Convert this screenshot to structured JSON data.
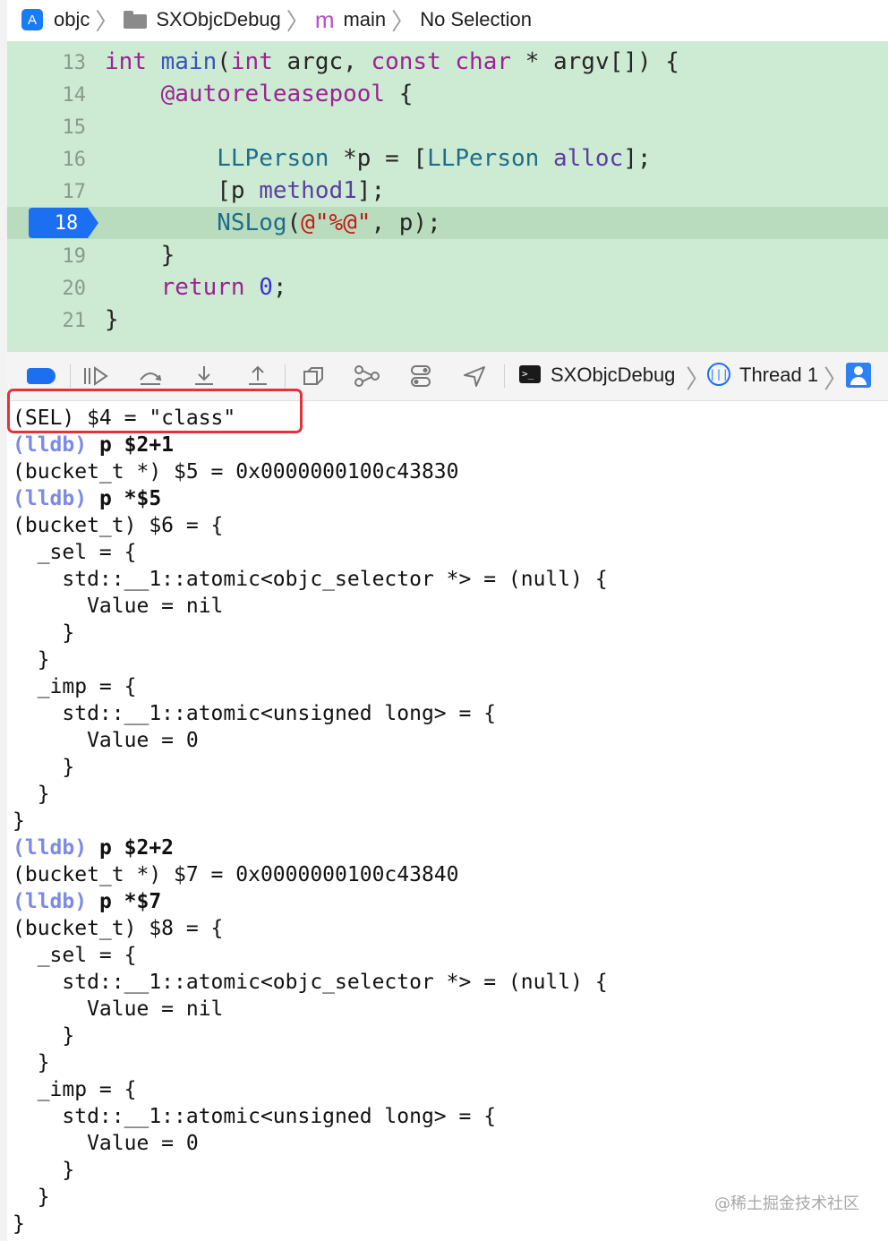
{
  "breadcrumb": {
    "project": "objc",
    "target": "SXObjcDebug",
    "file_icon_letter": "m",
    "function": "main",
    "selection": "No Selection"
  },
  "editor": {
    "lines": [
      {
        "num": "13",
        "code": "int main(int argc, const char * argv[]) {"
      },
      {
        "num": "14",
        "code": "    @autoreleasepool {"
      },
      {
        "num": "15",
        "code": ""
      },
      {
        "num": "16",
        "code": "        LLPerson *p = [LLPerson alloc];"
      },
      {
        "num": "17",
        "code": "        [p method1];"
      },
      {
        "num": "18",
        "code": "        NSLog(@\"%@\", p);"
      },
      {
        "num": "19",
        "code": "    }"
      },
      {
        "num": "20",
        "code": "    return 0;"
      },
      {
        "num": "21",
        "code": "}"
      }
    ],
    "current_line": "18",
    "highlight_color": "#cdebd2",
    "breakpoint_color": "#1d6ff2"
  },
  "debug_bar": {
    "process": "SXObjcDebug",
    "thread": "Thread 1",
    "icons": [
      "breakpoints-toggle-icon",
      "continue-icon",
      "step-over-icon",
      "step-into-icon",
      "step-out-icon",
      "view-hierarchy-icon",
      "memory-graph-icon",
      "environment-overrides-icon",
      "simulate-location-icon"
    ]
  },
  "console": {
    "lines": [
      {
        "type": "out",
        "text": "(SEL) $4 = \"class\""
      },
      {
        "type": "cmd",
        "prompt": "(lldb)",
        "text": " p $2+1"
      },
      {
        "type": "out",
        "text": "(bucket_t *) $5 = 0x0000000100c43830"
      },
      {
        "type": "cmd",
        "prompt": "(lldb)",
        "text": " p *$5"
      },
      {
        "type": "out",
        "text": "(bucket_t) $6 = {"
      },
      {
        "type": "out",
        "text": "  _sel = {"
      },
      {
        "type": "out",
        "text": "    std::__1::atomic<objc_selector *> = (null) {"
      },
      {
        "type": "out",
        "text": "      Value = nil"
      },
      {
        "type": "out",
        "text": "    }"
      },
      {
        "type": "out",
        "text": "  }"
      },
      {
        "type": "out",
        "text": "  _imp = {"
      },
      {
        "type": "out",
        "text": "    std::__1::atomic<unsigned long> = {"
      },
      {
        "type": "out",
        "text": "      Value = 0"
      },
      {
        "type": "out",
        "text": "    }"
      },
      {
        "type": "out",
        "text": "  }"
      },
      {
        "type": "out",
        "text": "}"
      },
      {
        "type": "cmd",
        "prompt": "(lldb)",
        "text": " p $2+2"
      },
      {
        "type": "out",
        "text": "(bucket_t *) $7 = 0x0000000100c43840"
      },
      {
        "type": "cmd",
        "prompt": "(lldb)",
        "text": " p *$7"
      },
      {
        "type": "out",
        "text": "(bucket_t) $8 = {"
      },
      {
        "type": "out",
        "text": "  _sel = {"
      },
      {
        "type": "out",
        "text": "    std::__1::atomic<objc_selector *> = (null) {"
      },
      {
        "type": "out",
        "text": "      Value = nil"
      },
      {
        "type": "out",
        "text": "    }"
      },
      {
        "type": "out",
        "text": "  }"
      },
      {
        "type": "out",
        "text": "  _imp = {"
      },
      {
        "type": "out",
        "text": "    std::__1::atomic<unsigned long> = {"
      },
      {
        "type": "out",
        "text": "      Value = 0"
      },
      {
        "type": "out",
        "text": "    }"
      },
      {
        "type": "out",
        "text": "  }"
      },
      {
        "type": "out",
        "text": "}"
      }
    ],
    "highlight_box_color": "#e2333b",
    "prompt_color": "#7a8ae6"
  },
  "watermark": "@稀土掘金技术社区"
}
